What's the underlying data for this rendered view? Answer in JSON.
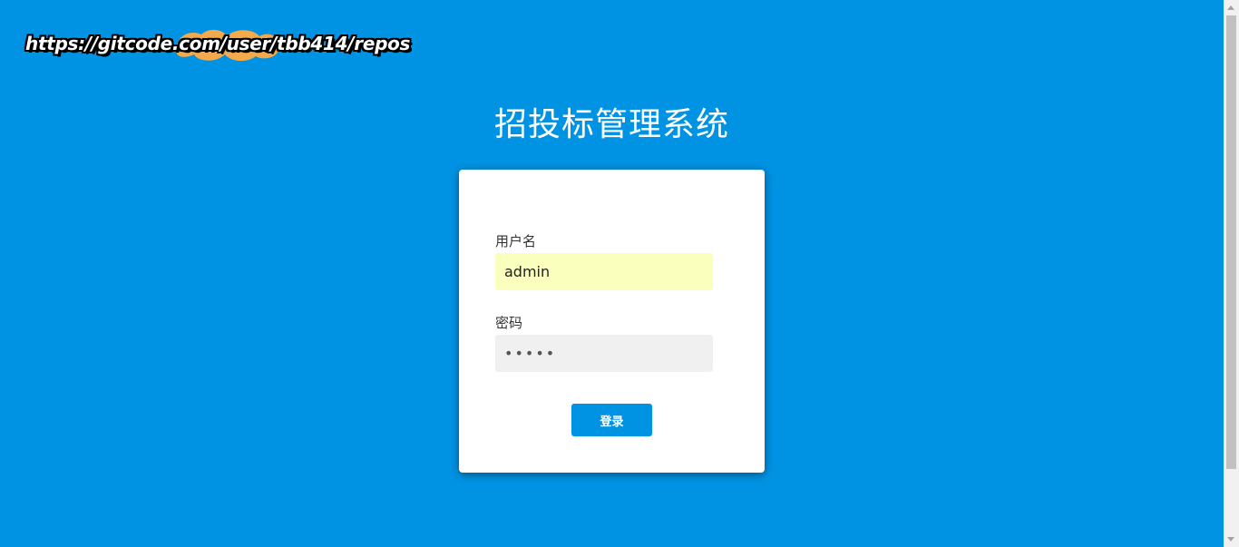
{
  "watermark": {
    "url": "https://gitcode.com/user/tbb414/repos"
  },
  "app": {
    "title": "招投标管理系统"
  },
  "login": {
    "username_label": "用户名",
    "username_value": "admin",
    "password_label": "密码",
    "password_value": "•••••",
    "submit_label": "登录"
  },
  "colors": {
    "background": "#0093e3",
    "card": "#ffffff",
    "autofill": "#faffbd",
    "password_bg": "#f0f0f0",
    "button": "#0093e3"
  }
}
